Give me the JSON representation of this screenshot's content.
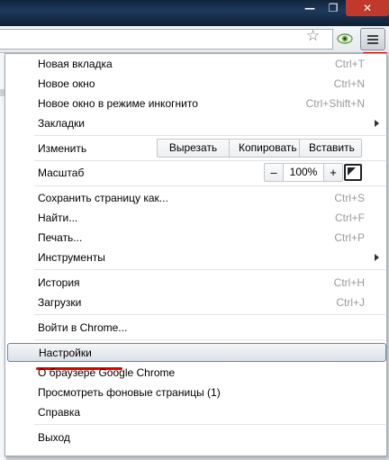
{
  "window": {
    "minimize_glyph": "—",
    "maximize_glyph": "❐",
    "close_glyph": "✕"
  },
  "toolbar": {
    "star_glyph": "☆"
  },
  "menu": {
    "new_tab": {
      "label": "Новая вкладка",
      "shortcut": "Ctrl+T"
    },
    "new_window": {
      "label": "Новое окно",
      "shortcut": "Ctrl+N"
    },
    "new_incognito": {
      "label": "Новое окно в режиме инкогнито",
      "shortcut": "Ctrl+Shift+N"
    },
    "bookmarks": {
      "label": "Закладки"
    },
    "edit": {
      "label": "Изменить",
      "cut": "Вырезать",
      "copy": "Копировать",
      "paste": "Вставить"
    },
    "zoom": {
      "label": "Масштаб",
      "minus": "–",
      "value": "100%",
      "plus": "+"
    },
    "save_page": {
      "label": "Сохранить страницу как...",
      "shortcut": "Ctrl+S"
    },
    "find": {
      "label": "Найти...",
      "shortcut": "Ctrl+F"
    },
    "print": {
      "label": "Печать...",
      "shortcut": "Ctrl+P"
    },
    "tools": {
      "label": "Инструменты"
    },
    "history": {
      "label": "История",
      "shortcut": "Ctrl+H"
    },
    "downloads": {
      "label": "Загрузки",
      "shortcut": "Ctrl+J"
    },
    "sign_in": {
      "label": "Войти в Chrome..."
    },
    "settings": {
      "label": "Настройки"
    },
    "about": {
      "label": "О браузере Google Chrome"
    },
    "background_pages": {
      "label": "Просмотреть фоновые страницы (1)"
    },
    "help": {
      "label": "Справка"
    },
    "exit": {
      "label": "Выход"
    }
  },
  "colors": {
    "highlight_border": "#4a8fcf",
    "annotation_red": "#e00000"
  }
}
